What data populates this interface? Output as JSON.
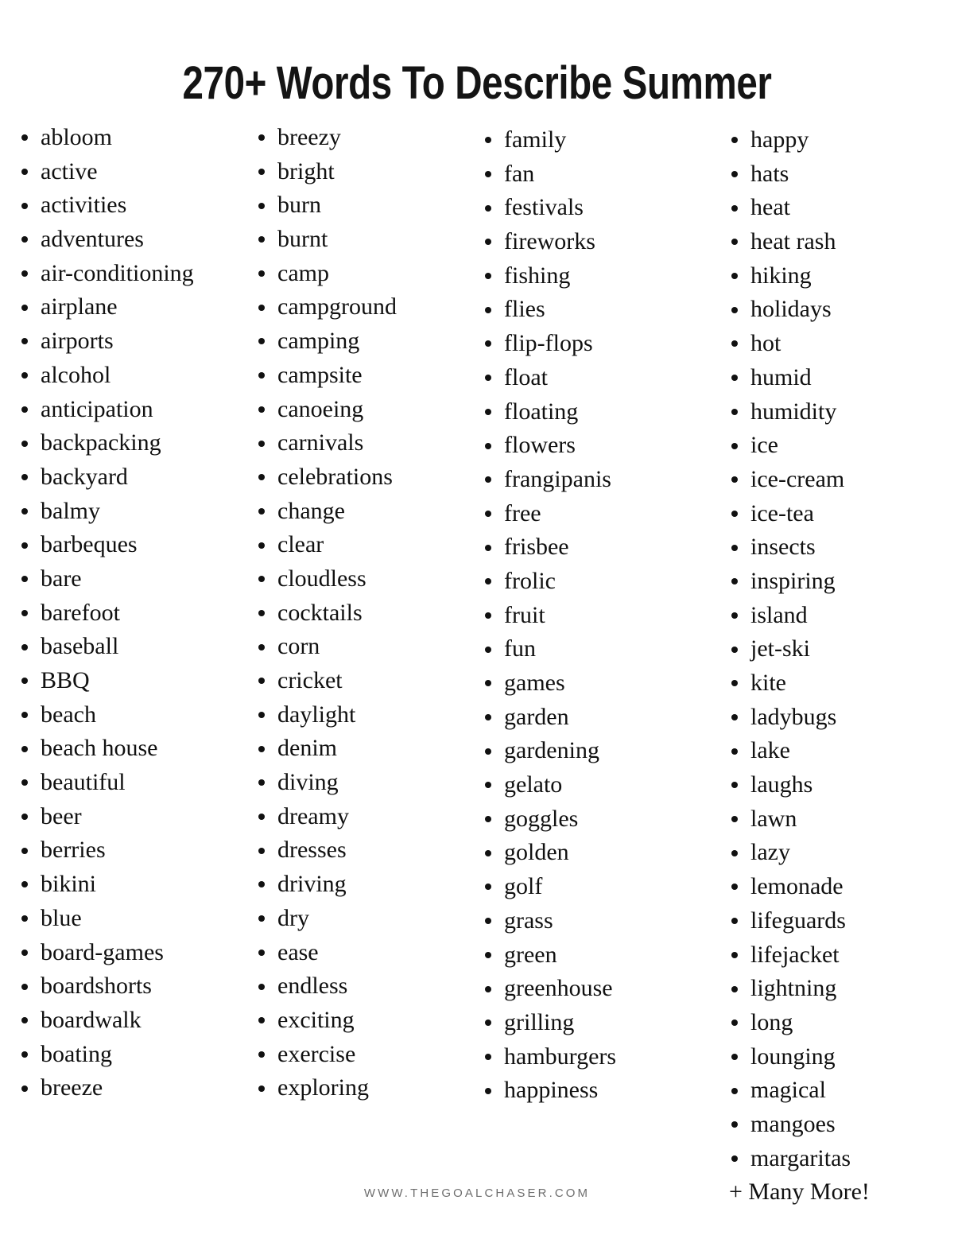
{
  "header": {
    "title": "270+ Words To Describe Summer"
  },
  "footer": {
    "site_url": "WWW.THEGOALCHASER.COM"
  },
  "colors": {
    "background": "#ffffff",
    "text": "#111111",
    "title": "#141414",
    "footer_text": "#6e6e6e",
    "bullet": "#111111"
  },
  "word_columns": [
    {
      "id": "column-1",
      "words": [
        "abloom",
        "active",
        "activities",
        "adventures",
        "air-conditioning",
        "airplane",
        "airports",
        "alcohol",
        "anticipation",
        "backpacking",
        "backyard",
        "balmy",
        "barbeques",
        "bare",
        "barefoot",
        "baseball",
        "BBQ",
        "beach",
        "beach house",
        "beautiful",
        "beer",
        "berries",
        "bikini",
        "blue",
        "board-games",
        "boardshorts",
        "boardwalk",
        "boating",
        "breeze"
      ]
    },
    {
      "id": "column-2",
      "words": [
        "breezy",
        "bright",
        "burn",
        "burnt",
        "camp",
        "campground",
        "camping",
        "campsite",
        "canoeing",
        "carnivals",
        "celebrations",
        "change",
        "clear",
        "cloudless",
        "cocktails",
        "corn",
        "cricket",
        "daylight",
        "denim",
        "diving",
        "dreamy",
        "dresses",
        "driving",
        "dry",
        "ease",
        "endless",
        "exciting",
        "exercise",
        "exploring"
      ]
    },
    {
      "id": "column-3",
      "words": [
        "family",
        "fan",
        "festivals",
        "fireworks",
        "fishing",
        "flies",
        "flip-flops",
        "float",
        "floating",
        "flowers",
        "frangipanis",
        "free",
        "frisbee",
        "frolic",
        "fruit",
        "fun",
        "games",
        "garden",
        "gardening",
        "gelato",
        "goggles",
        "golden",
        "golf",
        "grass",
        "green",
        "greenhouse",
        "grilling",
        "hamburgers",
        "happiness"
      ]
    },
    {
      "id": "column-4",
      "words": [
        "happy",
        "hats",
        "heat",
        "heat rash",
        "hiking",
        "holidays",
        "hot",
        "humid",
        "humidity",
        "ice",
        "ice-cream",
        "ice-tea",
        "insects",
        "inspiring",
        "island",
        "jet-ski",
        "kite",
        "ladybugs",
        "lake",
        "laughs",
        "lawn",
        "lazy",
        "lemonade",
        "lifeguards",
        "lifejacket",
        "lightning",
        "long",
        "lounging",
        "magical",
        "mangoes",
        "margaritas"
      ],
      "trailing_note": "+ Many More!"
    }
  ]
}
